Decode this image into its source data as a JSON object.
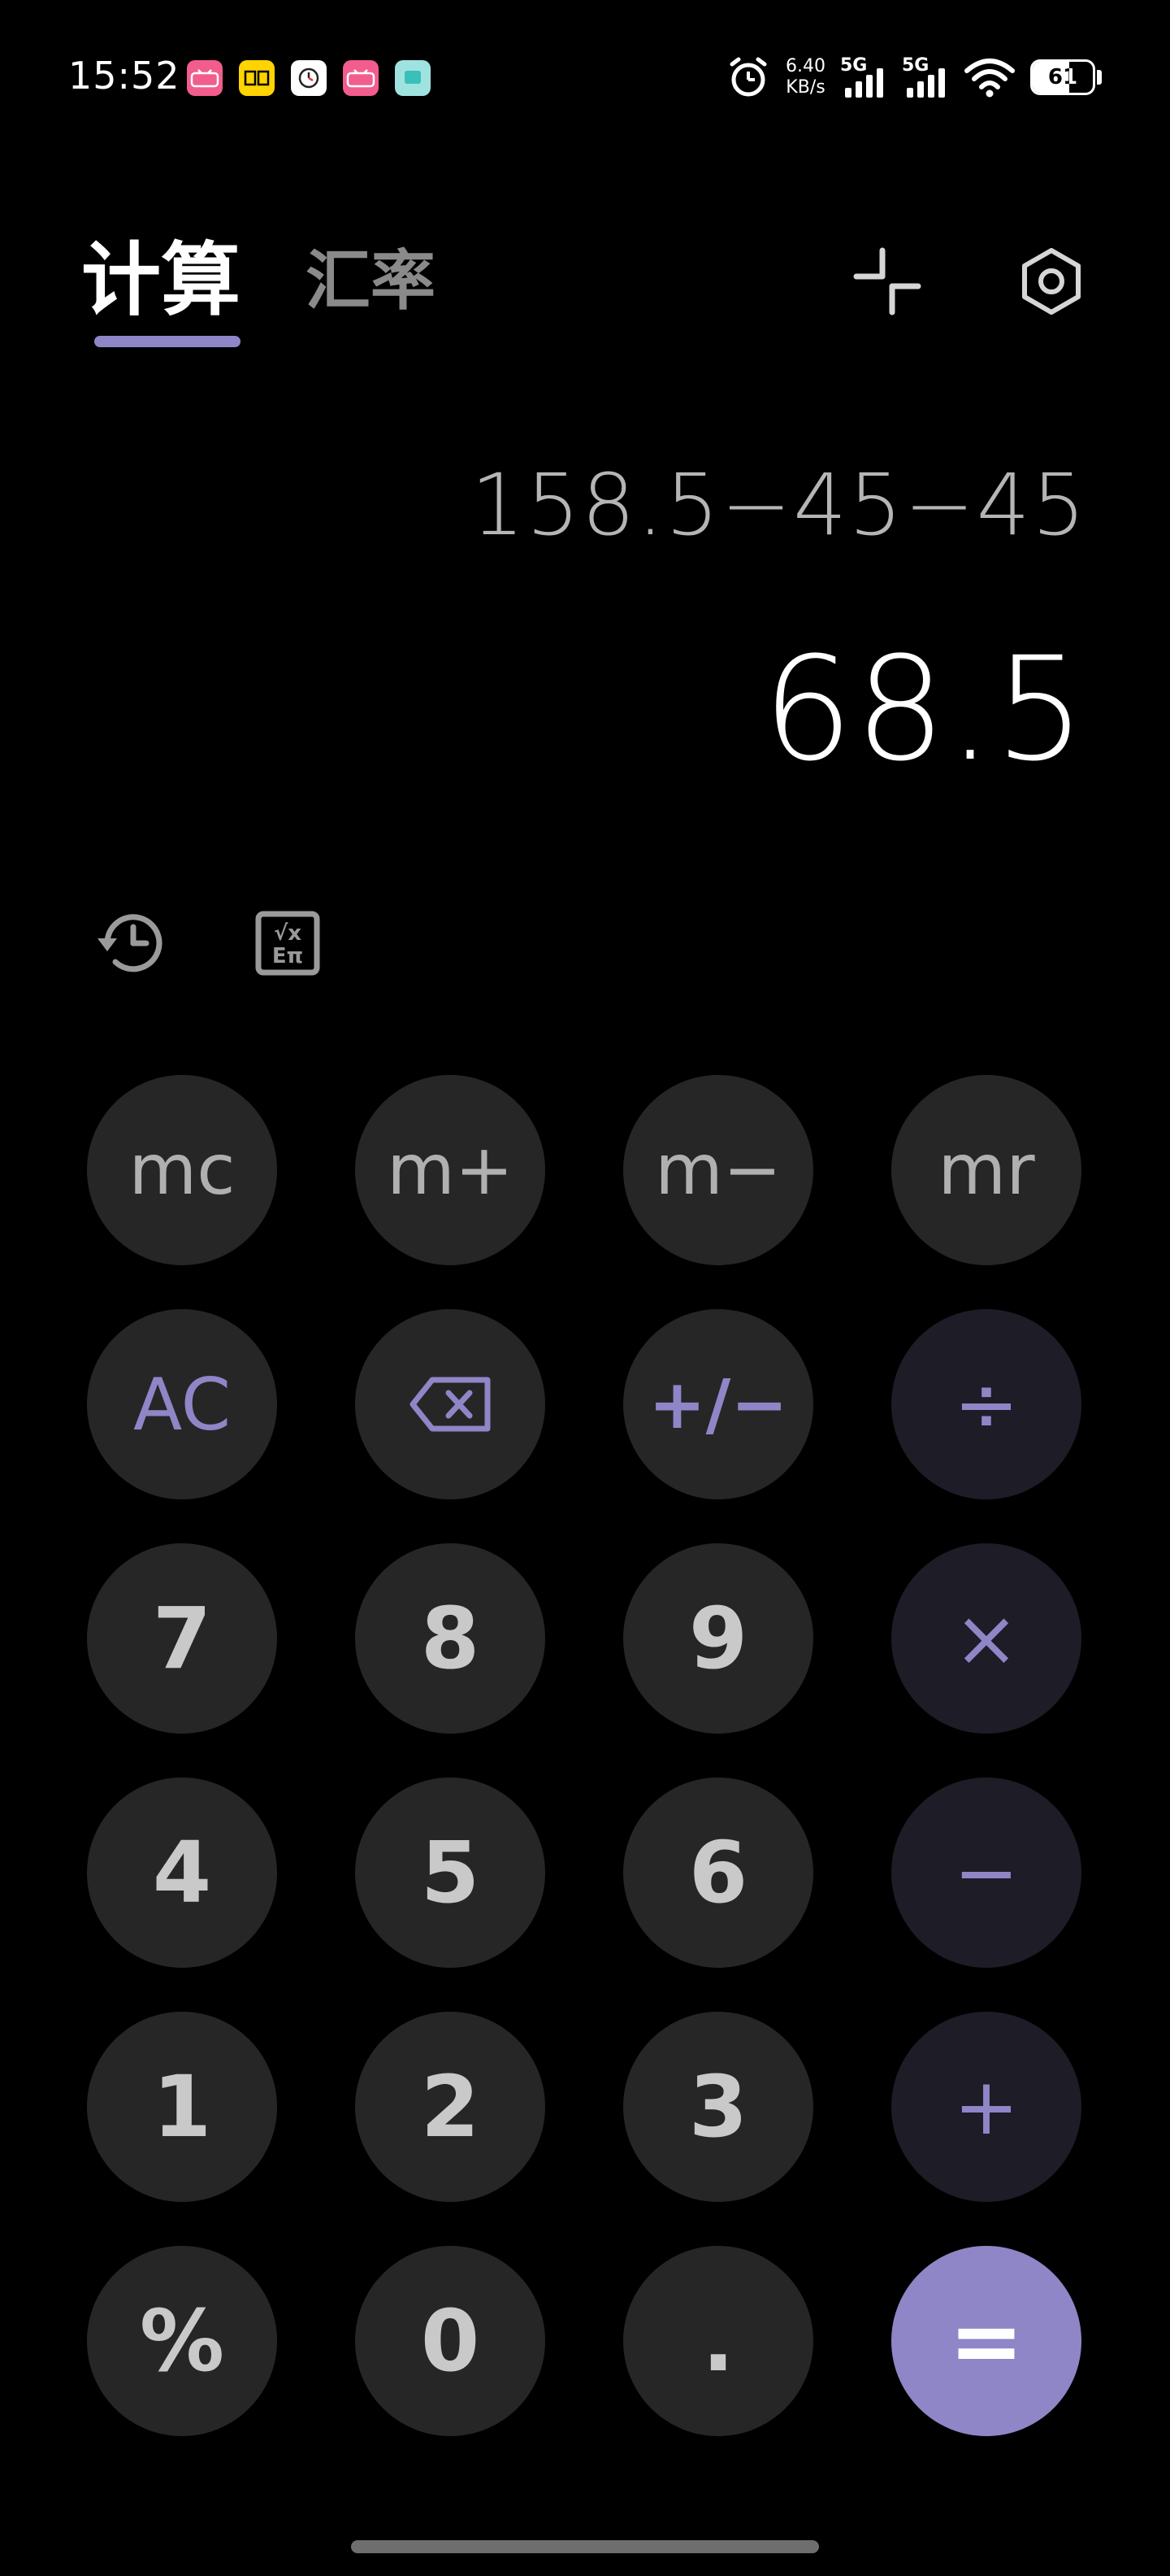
{
  "status_bar": {
    "time": "15:52",
    "notification_apps": [
      {
        "icon": "bilibili-icon",
        "label": "bilibili",
        "color": "#f25d8e"
      },
      {
        "icon": "reader-app-icon",
        "label": "阅",
        "color": "#ffd400"
      },
      {
        "icon": "clock-app-icon",
        "label": "",
        "color": "#ffffff"
      },
      {
        "icon": "bilibili-icon",
        "label": "bilibili",
        "color": "#f25d8e"
      },
      {
        "icon": "teal-app-icon",
        "label": "",
        "color": "#9fe3e0"
      }
    ],
    "net_speed_value": "6.40",
    "net_speed_unit": "KB/s",
    "signal_1_label": "5G",
    "signal_2_label": "5G",
    "battery_level": "61",
    "battery_fraction": 0.61
  },
  "tabs": {
    "calculator": "计算",
    "exchange_rate": "汇率",
    "active": "calculator"
  },
  "display": {
    "expression": "158.5−45−45",
    "result": "68.5"
  },
  "keypad": {
    "memory": [
      "mc",
      "m+",
      "m−",
      "mr"
    ],
    "clear": "AC",
    "sign_toggle": "+/−",
    "divide": "÷",
    "multiply": "×",
    "subtract": "−",
    "add": "+",
    "equals": "=",
    "percent": "%",
    "decimal": ".",
    "digits": {
      "d0": "0",
      "d1": "1",
      "d2": "2",
      "d3": "3",
      "d4": "4",
      "d5": "5",
      "d6": "6",
      "d7": "7",
      "d8": "8",
      "d9": "9"
    }
  },
  "colors": {
    "background": "#000000",
    "key_background": "#262626",
    "operator_background": "#1e1c26",
    "accent": "#8f86c7",
    "text_primary": "#ffffff",
    "text_secondary": "#b5b5b5"
  }
}
